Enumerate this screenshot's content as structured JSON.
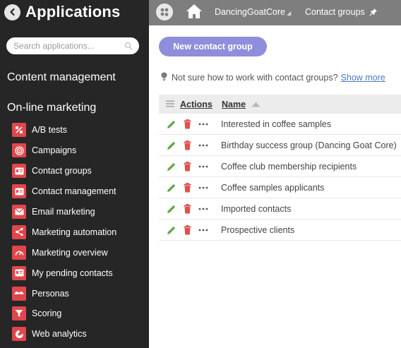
{
  "sidebar": {
    "title": "Applications",
    "search_placeholder": "Search applications...",
    "categories": [
      "Content management",
      "On-line marketing"
    ],
    "items": [
      {
        "label": "A/B tests",
        "icon": "ab-test-icon"
      },
      {
        "label": "Campaigns",
        "icon": "campaign-target-icon"
      },
      {
        "label": "Contact groups",
        "icon": "contact-card-icon"
      },
      {
        "label": "Contact management",
        "icon": "contact-card-icon"
      },
      {
        "label": "Email marketing",
        "icon": "envelope-icon"
      },
      {
        "label": "Marketing automation",
        "icon": "automation-flow-icon"
      },
      {
        "label": "Marketing overview",
        "icon": "gauge-icon"
      },
      {
        "label": "My pending contacts",
        "icon": "contact-card-icon"
      },
      {
        "label": "Personas",
        "icon": "persona-mustache-icon"
      },
      {
        "label": "Scoring",
        "icon": "funnel-icon"
      },
      {
        "label": "Web analytics",
        "icon": "pie-chart-icon"
      }
    ]
  },
  "topbar": {
    "site": "DancingGoatCore",
    "app": "Contact groups"
  },
  "main": {
    "new_button": "New contact group",
    "hint_text": "Not sure how to work with contact groups?",
    "hint_link": "Show more",
    "columns": {
      "actions": "Actions",
      "name": "Name"
    },
    "rows": [
      "Interested in coffee samples",
      "Birthday success group (Dancing Goat Core)",
      "Coffee club membership recipients",
      "Coffee samples applicants",
      "Imported contacts",
      "Prospective clients"
    ]
  },
  "colors": {
    "sidebar_bg": "#262626",
    "topbar_bg": "#7e7e7e",
    "accent_button": "#8e8edc",
    "icon_red": "#e0474c",
    "edit_green": "#6aa84f",
    "delete_red": "#d9534f",
    "link": "#4a7bbf"
  }
}
